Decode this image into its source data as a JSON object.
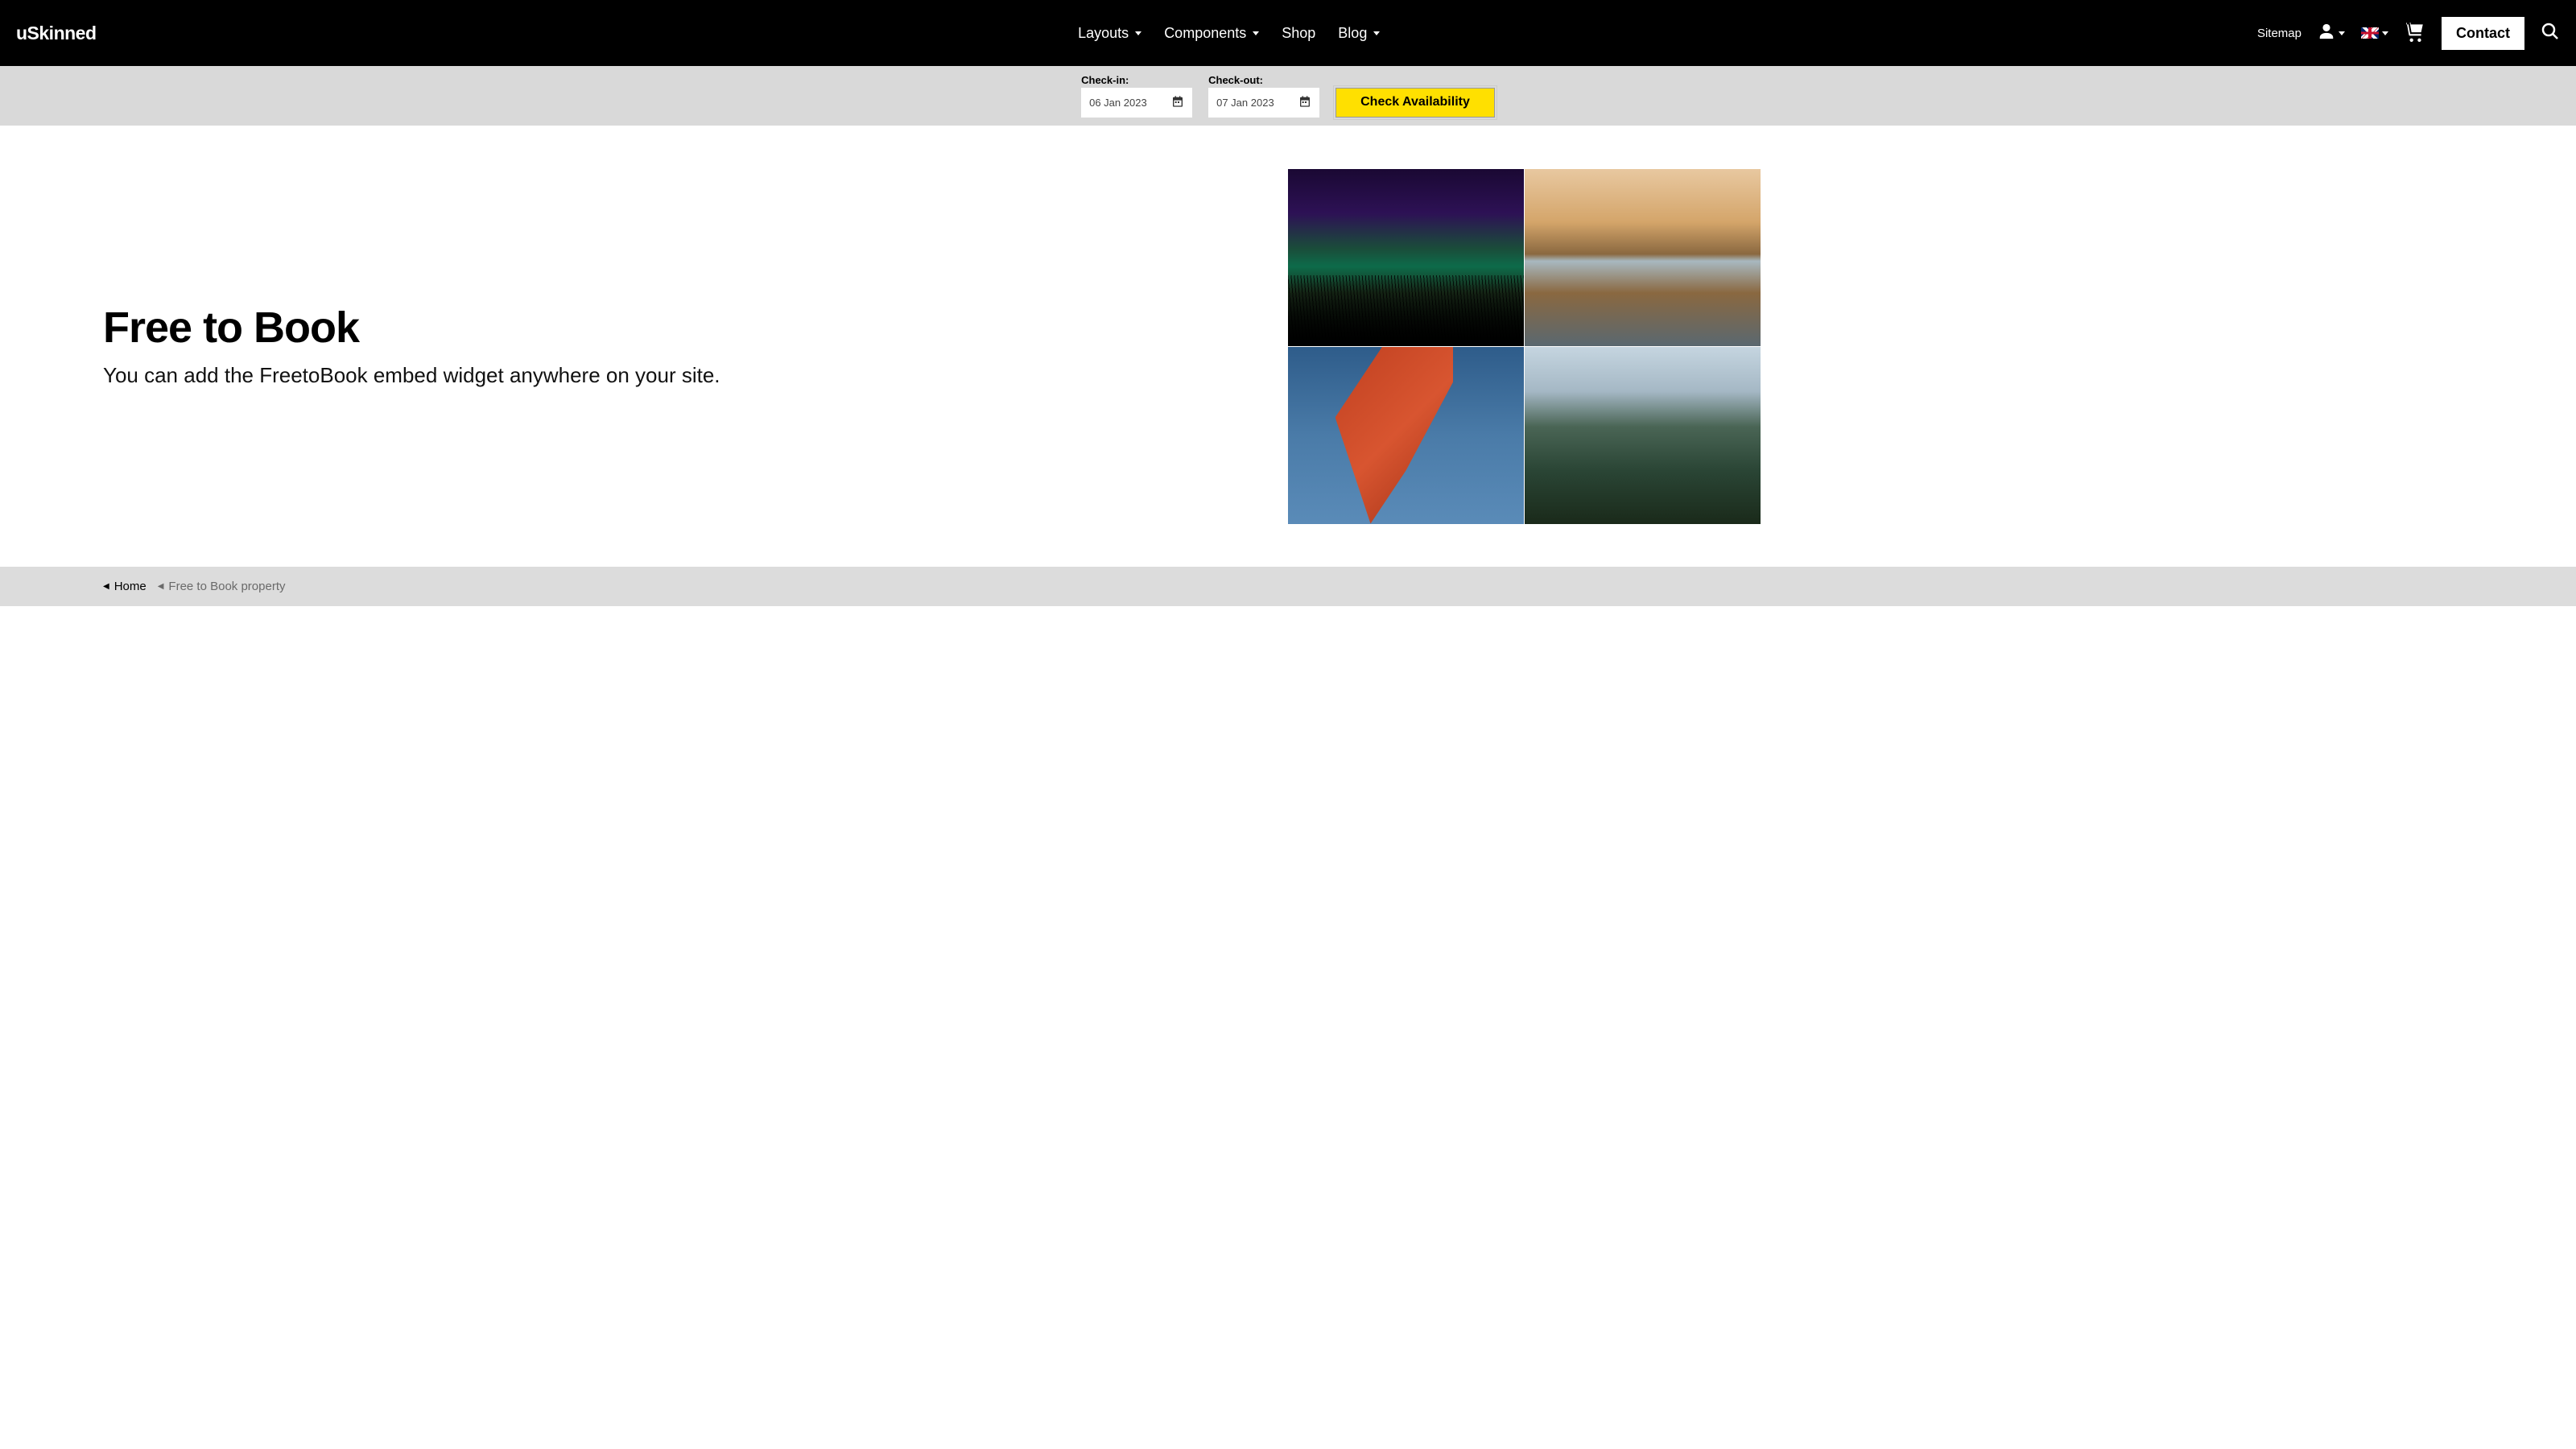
{
  "header": {
    "logo": "uSkinned",
    "nav": {
      "layouts": "Layouts",
      "components": "Components",
      "shop": "Shop",
      "blog": "Blog"
    },
    "sitemap": "Sitemap",
    "contact": "Contact"
  },
  "booking": {
    "checkin_label": "Check-in:",
    "checkout_label": "Check-out:",
    "checkin_value": "06 Jan 2023",
    "checkout_value": "07 Jan 2023",
    "button": "Check Availability"
  },
  "hero": {
    "title": "Free to Book",
    "subtitle": "You can add the FreetoBook embed widget anywhere on your site."
  },
  "breadcrumb": {
    "home": "Home",
    "current": "Free to Book property"
  }
}
